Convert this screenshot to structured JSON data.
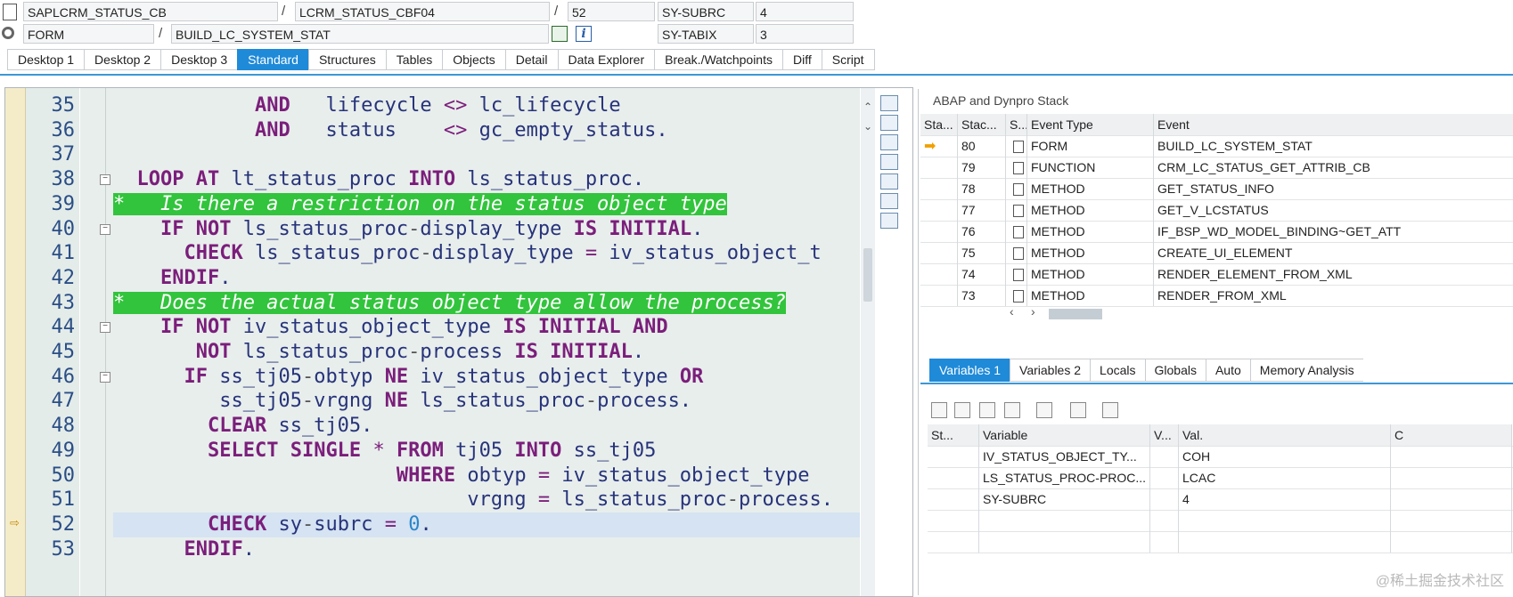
{
  "header": {
    "program": "SAPLCRM_STATUS_CB",
    "include": "LCRM_STATUS_CBF04",
    "line": "52",
    "var1_name": "SY-SUBRC",
    "var1_value": "4",
    "event_type": "FORM",
    "event_name": "BUILD_LC_SYSTEM_STAT",
    "var2_name": "SY-TABIX",
    "var2_value": "3",
    "slash": "/"
  },
  "tabs": [
    "Desktop 1",
    "Desktop 2",
    "Desktop 3",
    "Standard",
    "Structures",
    "Tables",
    "Objects",
    "Detail",
    "Data Explorer",
    "Break./Watchpoints",
    "Diff",
    "Script"
  ],
  "active_tab": "Standard",
  "code_lines": [
    {
      "no": "35",
      "text": "            AND   lifecycle <> lc_lifecycle"
    },
    {
      "no": "36",
      "text": "            AND   status    <> gc_empty_status."
    },
    {
      "no": "37",
      "text": ""
    },
    {
      "no": "38",
      "text": "  LOOP AT lt_status_proc INTO ls_status_proc."
    },
    {
      "no": "39",
      "text": "*   Is there a restriction on the status object type"
    },
    {
      "no": "40",
      "text": "    IF NOT ls_status_proc-display_type IS INITIAL."
    },
    {
      "no": "41",
      "text": "      CHECK ls_status_proc-display_type = iv_status_object_t"
    },
    {
      "no": "42",
      "text": "    ENDIF."
    },
    {
      "no": "43",
      "text": "*   Does the actual status object type allow the process?"
    },
    {
      "no": "44",
      "text": "    IF NOT iv_status_object_type IS INITIAL AND"
    },
    {
      "no": "45",
      "text": "       NOT ls_status_proc-process IS INITIAL."
    },
    {
      "no": "46",
      "text": "      IF ss_tj05-obtyp NE iv_status_object_type OR"
    },
    {
      "no": "47",
      "text": "         ss_tj05-vrgng NE ls_status_proc-process."
    },
    {
      "no": "48",
      "text": "        CLEAR ss_tj05."
    },
    {
      "no": "49",
      "text": "        SELECT SINGLE * FROM tj05 INTO ss_tj05"
    },
    {
      "no": "50",
      "text": "                        WHERE obtyp = iv_status_object_type"
    },
    {
      "no": "51",
      "text": "                              vrgng = ls_status_proc-process."
    },
    {
      "no": "52",
      "text": "        CHECK sy-subrc = 0."
    },
    {
      "no": "53",
      "text": "      ENDIF."
    }
  ],
  "stack": {
    "title": "ABAP and Dynpro Stack",
    "columns": [
      "Sta...",
      "Stac...",
      "S...",
      "Event Type",
      "Event"
    ],
    "rows": [
      {
        "level": "80",
        "type": "FORM",
        "event": "BUILD_LC_SYSTEM_STAT",
        "current": true
      },
      {
        "level": "79",
        "type": "FUNCTION",
        "event": "CRM_LC_STATUS_GET_ATTRIB_CB",
        "current": false
      },
      {
        "level": "78",
        "type": "METHOD",
        "event": "GET_STATUS_INFO",
        "current": false
      },
      {
        "level": "77",
        "type": "METHOD",
        "event": "GET_V_LCSTATUS",
        "current": false
      },
      {
        "level": "76",
        "type": "METHOD",
        "event": "IF_BSP_WD_MODEL_BINDING~GET_ATT",
        "current": false
      },
      {
        "level": "75",
        "type": "METHOD",
        "event": "CREATE_UI_ELEMENT",
        "current": false
      },
      {
        "level": "74",
        "type": "METHOD",
        "event": "RENDER_ELEMENT_FROM_XML",
        "current": false
      },
      {
        "level": "73",
        "type": "METHOD",
        "event": "RENDER_FROM_XML",
        "current": false
      }
    ]
  },
  "var_tabs": [
    "Variables 1",
    "Variables 2",
    "Locals",
    "Globals",
    "Auto",
    "Memory Analysis"
  ],
  "active_var_tab": "Variables 1",
  "vars": {
    "columns": [
      "St...",
      "Variable",
      "V...",
      "Val.",
      "C"
    ],
    "rows": [
      {
        "name": "IV_STATUS_OBJECT_TY...",
        "value": "COH"
      },
      {
        "name": "LS_STATUS_PROC-PROC...",
        "value": "LCAC"
      },
      {
        "name": "SY-SUBRC",
        "value": "4"
      }
    ]
  },
  "watermark": "@稀土掘金技术社区",
  "colors": {
    "accent": "#1f8ad8",
    "comment_bg": "#32c43c",
    "keyword": "#7b1e7b",
    "identifier": "#27337a",
    "number": "#2c86c9"
  }
}
